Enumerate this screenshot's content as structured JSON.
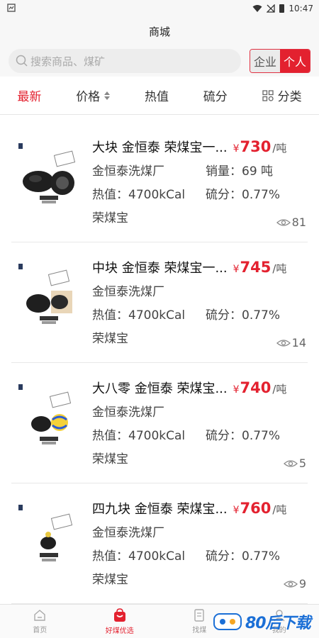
{
  "status_bar": {
    "time": "10:47"
  },
  "header": {
    "title": "商城"
  },
  "search": {
    "placeholder": "搜索商品、煤矿"
  },
  "mode_toggle": {
    "enterprise": "企业",
    "personal": "个人"
  },
  "filters": {
    "latest": "最新",
    "price": "价格",
    "heat": "热值",
    "sulfur": "硫分",
    "category": "分类"
  },
  "colors": {
    "accent": "#e3212f",
    "watermark": "#1b6fd6"
  },
  "products": [
    {
      "name": "大块 金恒泰 荣煤宝一...",
      "price_symbol": "¥",
      "price": "730",
      "unit": "/吨",
      "factory": "金恒泰洗煤厂",
      "sales": "销量：69 吨",
      "heat": "热值：4700kCal",
      "sulfur": "硫分：0.77%",
      "brand": "荣煤宝",
      "views": "81"
    },
    {
      "name": "中块 金恒泰 荣煤宝一...",
      "price_symbol": "¥",
      "price": "745",
      "unit": "/吨",
      "factory": "金恒泰洗煤厂",
      "sales": "",
      "heat": "热值：4700kCal",
      "sulfur": "硫分：0.77%",
      "brand": "荣煤宝",
      "views": "14"
    },
    {
      "name": "大八零 金恒泰 荣煤宝...",
      "price_symbol": "¥",
      "price": "740",
      "unit": "/吨",
      "factory": "金恒泰洗煤厂",
      "sales": "",
      "heat": "热值：4700kCal",
      "sulfur": "硫分：0.77%",
      "brand": "荣煤宝",
      "views": "5"
    },
    {
      "name": "四九块 金恒泰 荣煤宝...",
      "price_symbol": "¥",
      "price": "760",
      "unit": "/吨",
      "factory": "金恒泰洗煤厂",
      "sales": "",
      "heat": "热值：4700kCal",
      "sulfur": "硫分：0.77%",
      "brand": "荣煤宝",
      "views": "9"
    }
  ],
  "tabbar": {
    "home": "首页",
    "featured": "好煤优选",
    "find": "找煤",
    "mine": "我的"
  },
  "watermark": {
    "text": "80后下载"
  }
}
